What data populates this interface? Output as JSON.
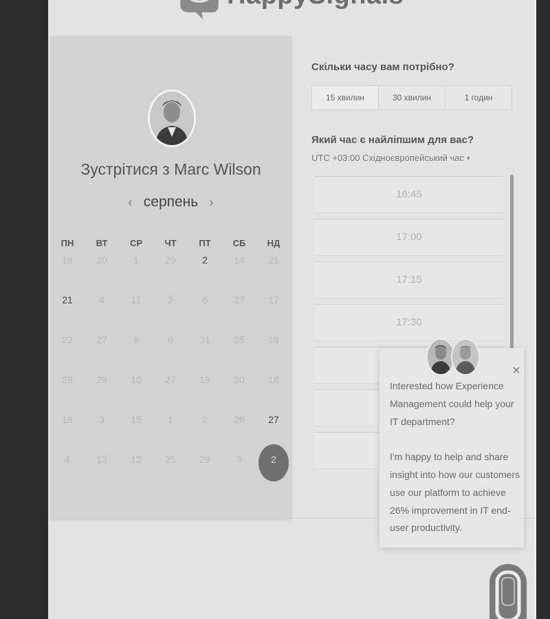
{
  "brand": {
    "name": "HappySignals"
  },
  "meeting": {
    "title": "Зустрітися з Marc Wilson",
    "month": "серпень",
    "prev_icon": "‹",
    "next_icon": "›"
  },
  "calendar": {
    "weekdays": [
      "ПН",
      "ВТ",
      "СР",
      "ЧТ",
      "ПТ",
      "СБ",
      "НД"
    ],
    "weeks": [
      [
        {
          "d": "18"
        },
        {
          "d": "20"
        },
        {
          "d": "1"
        },
        {
          "d": "29"
        },
        {
          "d": "2",
          "available": true
        },
        {
          "d": "14"
        },
        {
          "d": "21"
        }
      ],
      [
        {
          "d": "21",
          "available": true
        },
        {
          "d": "4"
        },
        {
          "d": "11"
        },
        {
          "d": "2"
        },
        {
          "d": "6"
        },
        {
          "d": "27"
        },
        {
          "d": "17"
        }
      ],
      [
        {
          "d": "23"
        },
        {
          "d": "27"
        },
        {
          "d": "8"
        },
        {
          "d": "6"
        },
        {
          "d": "31"
        },
        {
          "d": "25"
        },
        {
          "d": "18"
        }
      ],
      [
        {
          "d": "28"
        },
        {
          "d": "29"
        },
        {
          "d": "10"
        },
        {
          "d": "27"
        },
        {
          "d": "19"
        },
        {
          "d": "20"
        },
        {
          "d": "18"
        }
      ],
      [
        {
          "d": "18"
        },
        {
          "d": "3"
        },
        {
          "d": "15"
        },
        {
          "d": "1"
        },
        {
          "d": "2"
        },
        {
          "d": "26"
        },
        {
          "d": "27",
          "available": true
        }
      ],
      [
        {
          "d": "4"
        },
        {
          "d": "13"
        },
        {
          "d": "12"
        },
        {
          "d": "25"
        },
        {
          "d": "29"
        },
        {
          "d": "3"
        },
        {
          "d": "2",
          "selected": true
        }
      ]
    ]
  },
  "duration": {
    "heading": "Скільки часу вам потрібно?",
    "options": [
      "15 хвилин",
      "30 хвилин",
      "1 годин"
    ],
    "selected_index": 0
  },
  "time": {
    "heading": "Який час є найліпшим для вас?",
    "timezone": "UTC +03:00 Східноєвропейський час",
    "timezone_caret": "▾",
    "slots": [
      "16:45",
      "17:00",
      "17:15",
      "17:30",
      "",
      "",
      ""
    ]
  },
  "chat": {
    "message_1": "Interested how Experience Management could help your IT department?",
    "message_2": "I'm happy to help and share insight into how our customers use our platform to achieve 26% improvement in IT end-user productivity.",
    "close_icon": "×"
  }
}
